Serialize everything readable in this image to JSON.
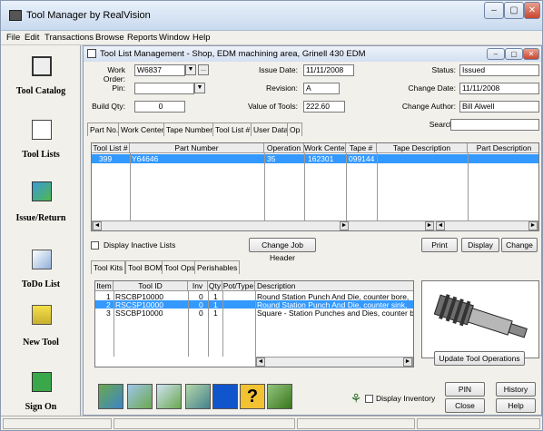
{
  "app": {
    "title": "Tool Manager by RealVision",
    "min": "–",
    "max": "▢",
    "close": "✕"
  },
  "menu": [
    "File",
    "Edit",
    "Transactions",
    "Browse",
    "Reports",
    "Window",
    "Help"
  ],
  "sidebar": [
    {
      "label": "Tool Catalog",
      "icon": "tool-catalog-icon"
    },
    {
      "label": "Tool Lists",
      "icon": "tool-lists-icon"
    },
    {
      "label": "Issue/Return",
      "icon": "issue-return-icon"
    },
    {
      "label": "ToDo List",
      "icon": "todo-list-icon"
    },
    {
      "label": "New Tool",
      "icon": "new-tool-icon"
    },
    {
      "label": "Sign On",
      "icon": "sign-on-icon"
    }
  ],
  "child": {
    "title": "Tool List Management - Shop, EDM machining area, Grinell 430 EDM",
    "work_order_label": "Work Order:",
    "work_order": "W6837",
    "pin_label": "Pin:",
    "pin": "",
    "build_qty_label": "Build Qty:",
    "build_qty": "0",
    "issue_date_label": "Issue Date:",
    "issue_date": "11/11/2008",
    "revision_label": "Revision:",
    "revision": "A",
    "value_label": "Value of Tools:",
    "value": "222.60",
    "status_label": "Status:",
    "status": "Issued",
    "change_date_label": "Change Date:",
    "change_date": "11/11/2008",
    "change_author_label": "Change Author:",
    "change_author": "Bill Alwell",
    "search_label": "Search:",
    "search": "",
    "ellipsis": "...",
    "dd": "▼"
  },
  "tabs_top": [
    "Part No.",
    "Work Center",
    "Tape Number",
    "Tool List #",
    "User Data",
    "Op"
  ],
  "list_grid": {
    "headers": [
      "Tool List #",
      "Part Number",
      "Operation",
      "Work Center",
      "Tape #",
      "Tape Description",
      "Part Description"
    ],
    "rows": [
      [
        "399",
        "Y64646",
        "35",
        "162301",
        "099144",
        "",
        ""
      ]
    ]
  },
  "display_inactive": "Display Inactive Lists",
  "change_job_header": "Change Job Header",
  "print": "Print",
  "display": "Display",
  "change": "Change",
  "tabs_bottom": [
    "Tool Kits",
    "Tool BOM",
    "Tool Ops",
    "Perishables"
  ],
  "tool_grid": {
    "headers": [
      "Item",
      "Tool ID",
      "Inv",
      "Qty",
      "Pot/Type",
      "Description"
    ],
    "rows": [
      [
        "1",
        "RSCBP10000",
        "0",
        "1",
        "",
        "Round Station Punch And Die, counter bore,"
      ],
      [
        "2",
        "RSCSP10000",
        "0",
        "1",
        "",
        "Round Station Punch And Die, counter sink,"
      ],
      [
        "3",
        "SSCBP10000",
        "0",
        "1",
        "",
        "Square - Station Punches and Dies, counter b"
      ]
    ]
  },
  "update_ops": "Update Tool Operations",
  "display_inventory": "Display Inventory",
  "pin_btn": "PIN",
  "history": "History",
  "close_btn": "Close",
  "help": "Help",
  "arrow_left": "◄",
  "arrow_right": "►",
  "arrow_up": "▲",
  "arrow_down": "▼"
}
